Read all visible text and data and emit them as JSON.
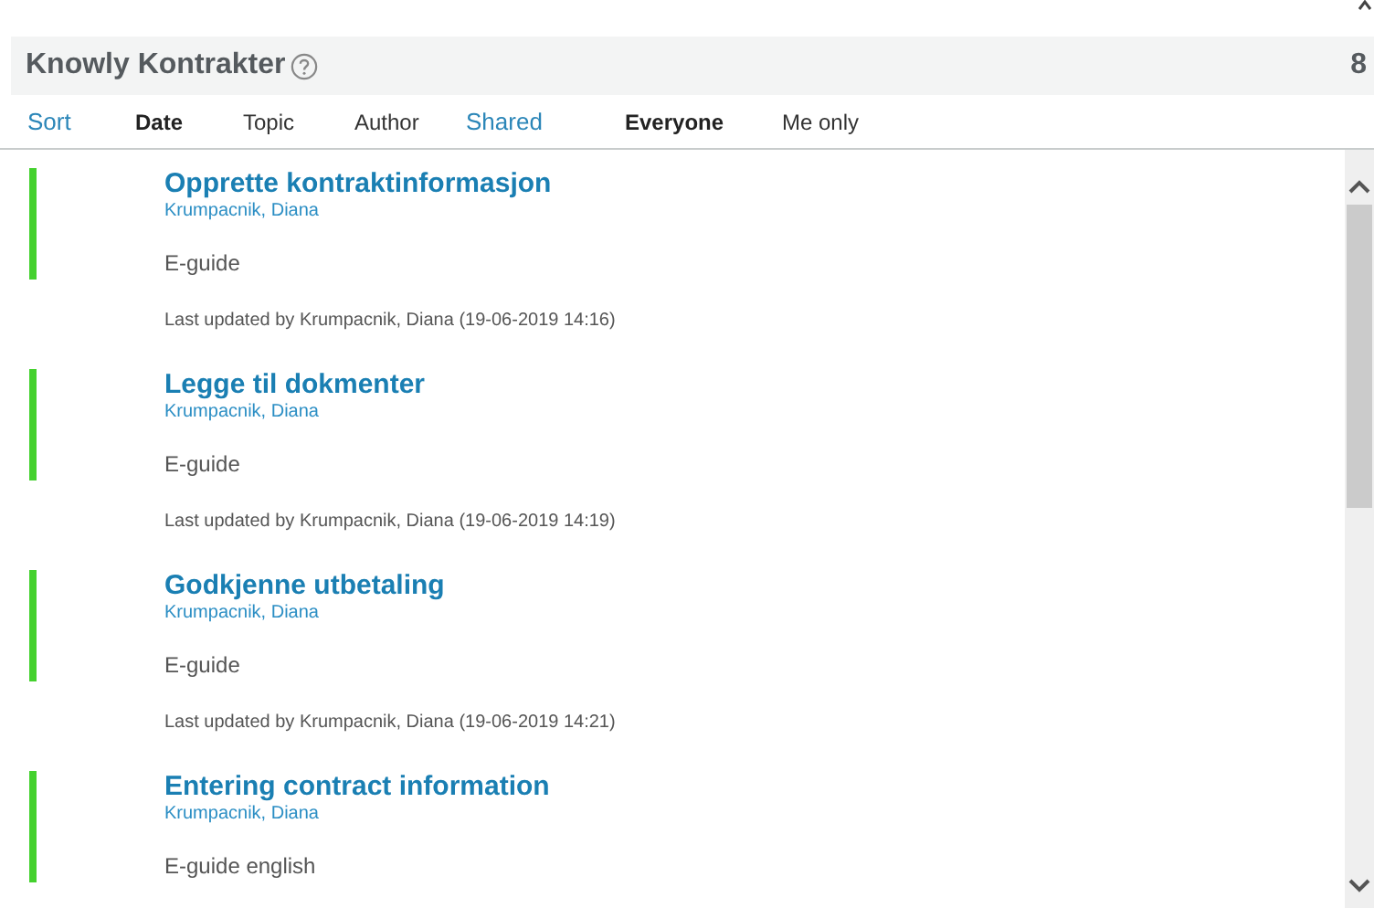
{
  "header": {
    "title": "Knowly Kontrakter",
    "count": "8"
  },
  "filters": [
    {
      "label": "Sort",
      "options": [
        {
          "label": "Date",
          "selected": true
        },
        {
          "label": "Topic",
          "selected": false
        },
        {
          "label": "Author",
          "selected": false
        }
      ]
    },
    {
      "label": "Shared",
      "options": [
        {
          "label": "Everyone",
          "selected": true
        },
        {
          "label": "Me only",
          "selected": false
        }
      ]
    }
  ],
  "items": [
    {
      "title": "Opprette kontraktinformasjon",
      "author": "Krumpacnik, Diana",
      "type": "E-guide",
      "updated": "Last updated by Krumpacnik, Diana (19-06-2019 14:16)"
    },
    {
      "title": "Legge til dokmenter",
      "author": "Krumpacnik, Diana",
      "type": "E-guide",
      "updated": "Last updated by Krumpacnik, Diana (19-06-2019 14:19)"
    },
    {
      "title": "Godkjenne utbetaling",
      "author": "Krumpacnik, Diana",
      "type": "E-guide",
      "updated": "Last updated by Krumpacnik, Diana (19-06-2019 14:21)"
    },
    {
      "title": "Entering contract information",
      "author": "Krumpacnik, Diana",
      "type": "E-guide english"
    }
  ]
}
